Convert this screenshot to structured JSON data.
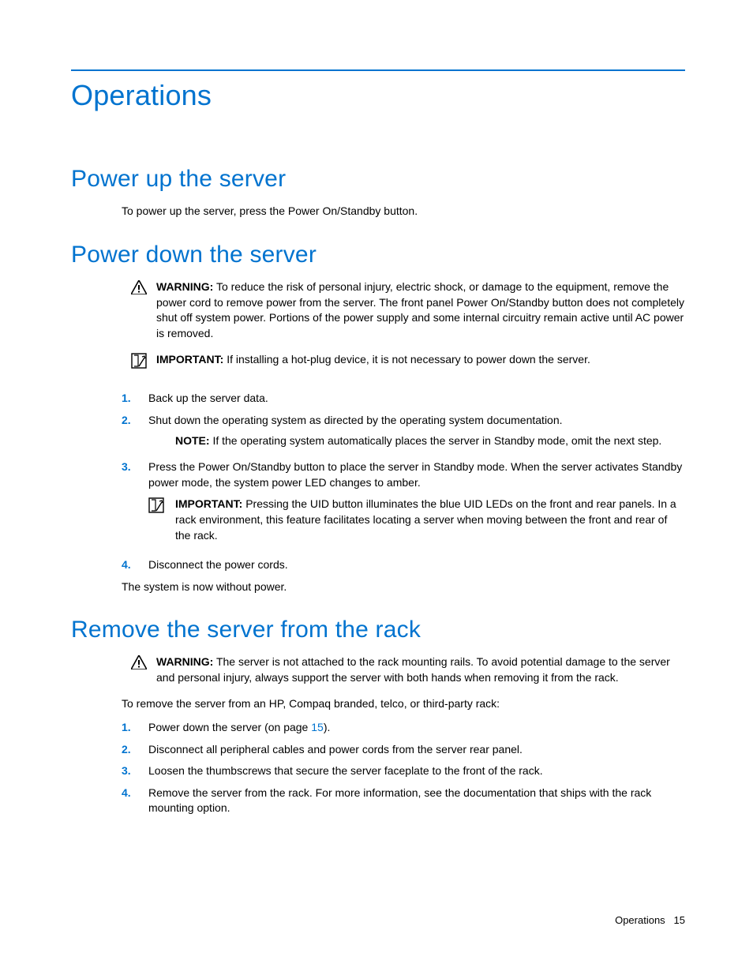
{
  "title": "Operations",
  "section_powerup": {
    "heading": "Power up the server",
    "text": "To power up the server, press the Power On/Standby button."
  },
  "section_powerdown": {
    "heading": "Power down the server",
    "warning_label": "WARNING:",
    "warning_text": "To reduce the risk of personal injury, electric shock, or damage to the equipment, remove the power cord to remove power from the server. The front panel Power On/Standby button does not completely shut off system power. Portions of the power supply and some internal circuitry remain active until AC power is removed.",
    "important1_label": "IMPORTANT:",
    "important1_text": "If installing a hot-plug device, it is not necessary to power down the server.",
    "steps": [
      "Back up the server data.",
      "Shut down the operating system as directed by the operating system documentation.",
      "Press the Power On/Standby button to place the server in Standby mode. When the server activates Standby power mode, the system power LED changes to amber.",
      "Disconnect the power cords."
    ],
    "note_label": "NOTE:",
    "note_text": "If the operating system automatically places the server in Standby mode, omit the next step.",
    "important2_label": "IMPORTANT:",
    "important2_text": "Pressing the UID button illuminates the blue UID LEDs on the front and rear panels. In a rack environment, this feature facilitates locating a server when moving between the front and rear of the rack.",
    "after": "The system is now without power."
  },
  "section_remove": {
    "heading": "Remove the server from the rack",
    "warning_label": "WARNING:",
    "warning_text": "The server is not attached to the rack mounting rails. To avoid potential damage to the server and personal injury, always support the server with both hands when removing it from the rack.",
    "intro": "To remove the server from an HP, Compaq branded, telco, or third-party rack:",
    "steps_pre1": "Power down the server (on page ",
    "steps_link1": "15",
    "steps_post1": ").",
    "steps": [
      "",
      "Disconnect all peripheral cables and power cords from the server rear panel.",
      "Loosen the thumbscrews that secure the server faceplate to the front of the rack.",
      "Remove the server from the rack. For more information, see the documentation that ships with the rack mounting option."
    ]
  },
  "numbers": {
    "n1": "1.",
    "n2": "2.",
    "n3": "3.",
    "n4": "4."
  },
  "footer": {
    "section": "Operations",
    "page": "15"
  }
}
